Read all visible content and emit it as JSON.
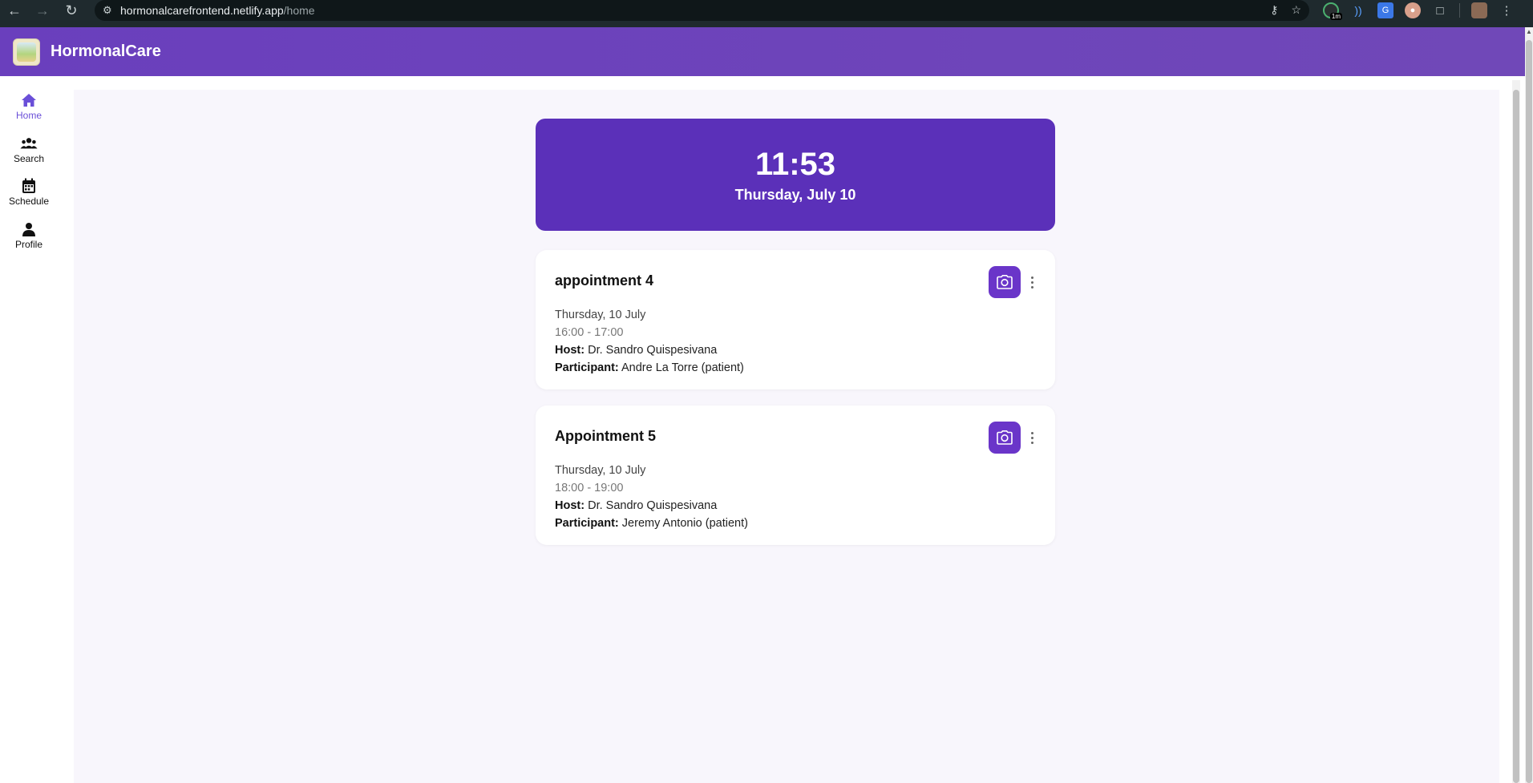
{
  "browser": {
    "url_host": "hormonalcarefrontend.netlify.app",
    "url_path": "/home",
    "extension_badge": "1m"
  },
  "header": {
    "app_title": "HormonalCare"
  },
  "sidebar": {
    "items": [
      {
        "label": "Home",
        "icon": "home-icon",
        "active": true
      },
      {
        "label": "Search",
        "icon": "users-icon",
        "active": false
      },
      {
        "label": "Schedule",
        "icon": "calendar-icon",
        "active": false
      },
      {
        "label": "Profile",
        "icon": "person-icon",
        "active": false
      }
    ]
  },
  "clock": {
    "time": "11:53",
    "date": "Thursday, July 10"
  },
  "appointments": [
    {
      "title": "appointment 4",
      "date": "Thursday, 10 July",
      "time": "16:00 - 17:00",
      "host_label": "Host:",
      "host": "Dr. Sandro Quispesivana",
      "participant_label": "Participant:",
      "participant": "Andre La Torre (patient)"
    },
    {
      "title": "Appointment 5",
      "date": "Thursday, 10 July",
      "time": "18:00 - 19:00",
      "host_label": "Host:",
      "host": "Dr. Sandro Quispesivana",
      "participant_label": "Participant:",
      "participant": "Jeremy Antonio (patient)"
    }
  ],
  "colors": {
    "header": "#6a3fbd",
    "clock_card": "#5b30b9",
    "camera_button": "#6a35c9",
    "active_nav": "#6a4fd8",
    "background": "#f8f6fc"
  }
}
